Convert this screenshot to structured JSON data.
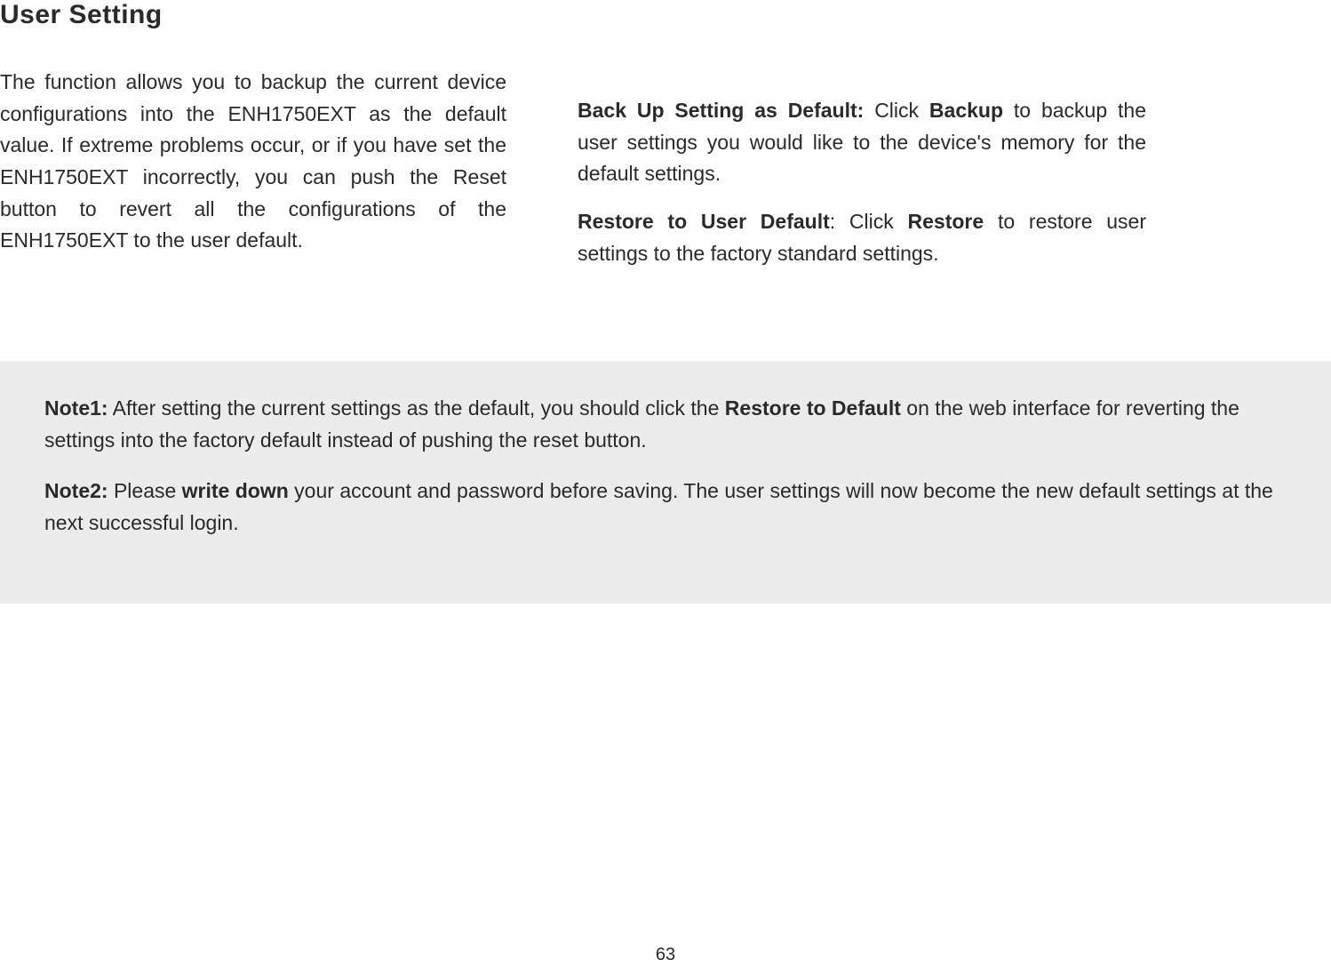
{
  "heading": "User Setting",
  "leftParagraph": "The function allows you to backup the current device configurations into the ENH1750EXT as the default value. If extreme problems occur, or if you have set the ENH1750EXT incorrectly, you can push the Reset button to revert all the configurations of the ENH1750EXT to the user default.",
  "right": {
    "backup_label": "Back Up Setting as Default:",
    "backup_pre": "  Click ",
    "backup_bold": "Backup",
    "backup_post": " to backup the user settings you would like to the device's memory for the default settings.",
    "restore_label": "Restore to User Default",
    "restore_pre": ": Click ",
    "restore_bold": "Restore",
    "restore_post": " to restore user settings to the factory standard settings."
  },
  "notes": {
    "note1_label": "Note1:",
    "note1_pre": " After setting the current settings as the default, you should click the ",
    "note1_bold": "Restore to Default",
    "note1_post": " on the web interface for reverting the settings into the factory default instead of pushing the reset button.",
    "note2_label": "Note2:",
    "note2_pre": " Please ",
    "note2_bold": "write down",
    "note2_post": " your account and password before saving. The user settings will now become the new default settings at the next successful login."
  },
  "pageNumber": "63"
}
